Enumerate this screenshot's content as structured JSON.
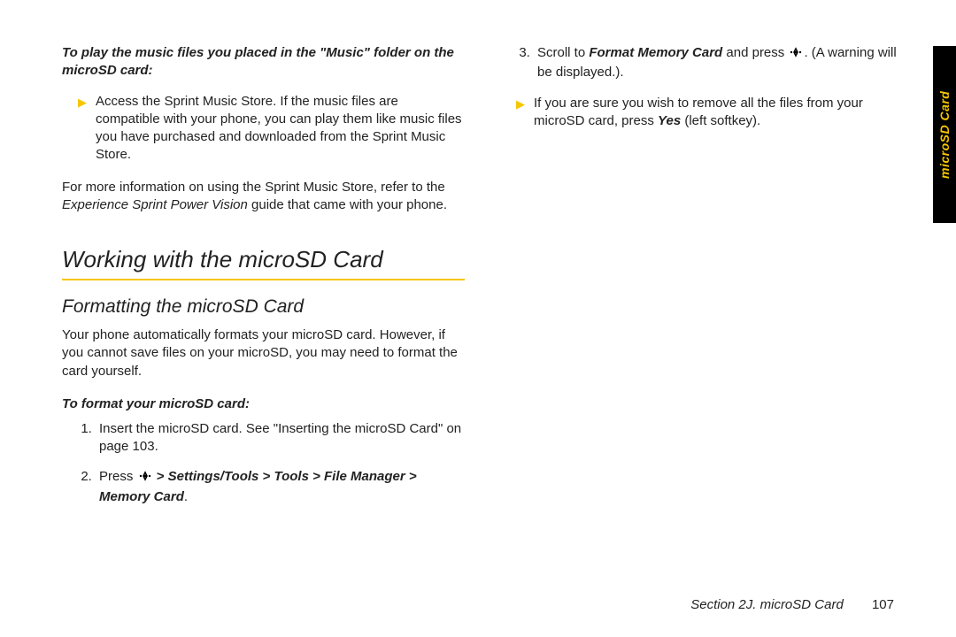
{
  "sideTab": "microSD Card",
  "left": {
    "intro": "To play the music files you placed in the \"Music\" folder on the microSD card:",
    "bullet1": "Access the Sprint Music Store. If the music files are compatible with your phone, you can play them like music files you have purchased and downloaded from the Sprint Music Store.",
    "moreInfo_a": "For more information on using the Sprint Music Store, refer to the ",
    "moreInfo_ital": "Experience Sprint Power Vision",
    "moreInfo_b": " guide that came with your phone.",
    "h1": "Working with the microSD Card",
    "h2": "Formatting the microSD Card",
    "formatPara": "Your phone automatically formats your microSD card. However, if you cannot save files on your microSD, you may need to format the card yourself.",
    "formatSub": "To format your microSD card:",
    "step1": "Insert the microSD card. See \"Inserting the microSD Card\" on page 103.",
    "step2_a": "Press ",
    "step2_b": " > Settings/Tools > Tools > File Manager > Memory Card"
  },
  "right": {
    "step3_a": "Scroll to ",
    "step3_bold": "Format Memory Card",
    "step3_b": " and press ",
    "step3_c": ". (A warning will be displayed.).",
    "bullet_a": "If you are sure you wish to remove all the files from your microSD card, press ",
    "bullet_bold": "Yes",
    "bullet_b": " (left softkey)."
  },
  "footer": {
    "section": "Section 2J. microSD Card",
    "page": "107"
  }
}
